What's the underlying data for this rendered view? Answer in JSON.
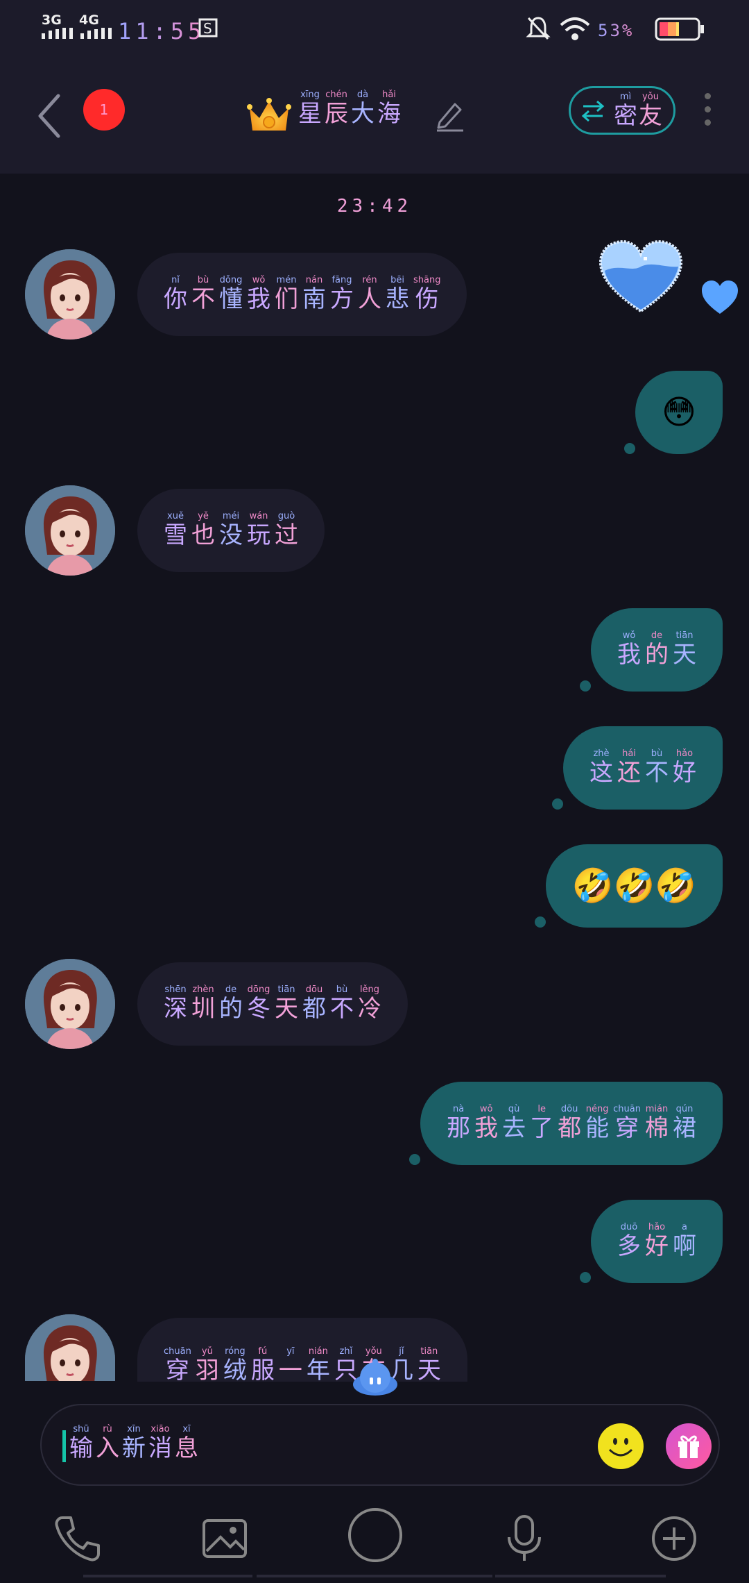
{
  "status_bar": {
    "net1": "3G",
    "net2": "4G",
    "time": "11:55",
    "battery_pct": "53%"
  },
  "header": {
    "unread_count": "1",
    "title": [
      {
        "py": "xīng",
        "hz": "星"
      },
      {
        "py": "chén",
        "hz": "辰"
      },
      {
        "py": "dà",
        "hz": "大"
      },
      {
        "py": "hǎi",
        "hz": "海"
      }
    ],
    "friend_tag": [
      {
        "py": "mì",
        "hz": "密"
      },
      {
        "py": "yǒu",
        "hz": "友"
      }
    ]
  },
  "chat": {
    "timestamp": "23:42",
    "messages": [
      {
        "side": "in",
        "ruby": [
          {
            "py": "nǐ",
            "hz": "你"
          },
          {
            "py": "bù",
            "hz": "不"
          },
          {
            "py": "dǒng",
            "hz": "懂"
          },
          {
            "py": "wǒ",
            "hz": "我"
          },
          {
            "py": "mén",
            "hz": "们"
          },
          {
            "py": "nán",
            "hz": "南"
          },
          {
            "py": "fāng",
            "hz": "方"
          },
          {
            "py": "rén",
            "hz": "人"
          },
          {
            "py": "bēi",
            "hz": "悲"
          },
          {
            "py": "shāng",
            "hz": "伤"
          }
        ]
      },
      {
        "side": "out",
        "emoji": "😳"
      },
      {
        "side": "in",
        "ruby": [
          {
            "py": "xuě",
            "hz": "雪"
          },
          {
            "py": "yě",
            "hz": "也"
          },
          {
            "py": "méi",
            "hz": "没"
          },
          {
            "py": "wán",
            "hz": "玩"
          },
          {
            "py": "guò",
            "hz": "过"
          }
        ]
      },
      {
        "side": "out",
        "ruby": [
          {
            "py": "wǒ",
            "hz": "我"
          },
          {
            "py": "de",
            "hz": "的"
          },
          {
            "py": "tiān",
            "hz": "天"
          }
        ]
      },
      {
        "side": "out",
        "ruby": [
          {
            "py": "zhè",
            "hz": "这"
          },
          {
            "py": "hái",
            "hz": "还"
          },
          {
            "py": "bù",
            "hz": "不"
          },
          {
            "py": "hǎo",
            "hz": "好"
          }
        ]
      },
      {
        "side": "out",
        "emoji": "🤣🤣🤣"
      },
      {
        "side": "in",
        "ruby": [
          {
            "py": "shēn",
            "hz": "深"
          },
          {
            "py": "zhèn",
            "hz": "圳"
          },
          {
            "py": "de",
            "hz": "的"
          },
          {
            "py": "dōng",
            "hz": "冬"
          },
          {
            "py": "tiān",
            "hz": "天"
          },
          {
            "py": "dōu",
            "hz": "都"
          },
          {
            "py": "bù",
            "hz": "不"
          },
          {
            "py": "lěng",
            "hz": "冷"
          }
        ]
      },
      {
        "side": "out",
        "ruby": [
          {
            "py": "nà",
            "hz": "那"
          },
          {
            "py": "wǒ",
            "hz": "我"
          },
          {
            "py": "qù",
            "hz": "去"
          },
          {
            "py": "le",
            "hz": "了"
          },
          {
            "py": "dōu",
            "hz": "都"
          },
          {
            "py": "néng",
            "hz": "能"
          },
          {
            "py": "chuān",
            "hz": "穿"
          },
          {
            "py": "mián",
            "hz": "棉"
          },
          {
            "py": "qún",
            "hz": "裙"
          }
        ]
      },
      {
        "side": "out",
        "ruby": [
          {
            "py": "duō",
            "hz": "多"
          },
          {
            "py": "hǎo",
            "hz": "好"
          },
          {
            "py": "a",
            "hz": "啊"
          }
        ]
      },
      {
        "side": "in",
        "ruby": [
          {
            "py": "chuān",
            "hz": "穿"
          },
          {
            "py": "yǔ",
            "hz": "羽"
          },
          {
            "py": "róng",
            "hz": "绒"
          },
          {
            "py": "fú",
            "hz": "服"
          },
          {
            "py": "yī",
            "hz": "一"
          },
          {
            "py": "nián",
            "hz": "年"
          },
          {
            "py": "zhǐ",
            "hz": "只"
          },
          {
            "py": "yǒu",
            "hz": "有"
          },
          {
            "py": "jǐ",
            "hz": "几"
          },
          {
            "py": "tiān",
            "hz": "天"
          }
        ]
      }
    ]
  },
  "input": {
    "placeholder": [
      {
        "py": "shū",
        "hz": "输"
      },
      {
        "py": "rù",
        "hz": "入"
      },
      {
        "py": "xīn",
        "hz": "新"
      },
      {
        "py": "xiāo",
        "hz": "消"
      },
      {
        "py": "xī",
        "hz": "息"
      }
    ]
  },
  "toolbar": {
    "icons": [
      "phone-icon",
      "image-icon",
      "circle-icon",
      "microphone-icon",
      "plus-icon"
    ]
  },
  "colors": {
    "background": "#12121c",
    "header": "#1c1b2a",
    "incoming_bubble": "#1d1c2b",
    "outgoing_bubble": "#1b5f66",
    "accent": "#1e9ca0",
    "badge": "#ff2a2a"
  }
}
